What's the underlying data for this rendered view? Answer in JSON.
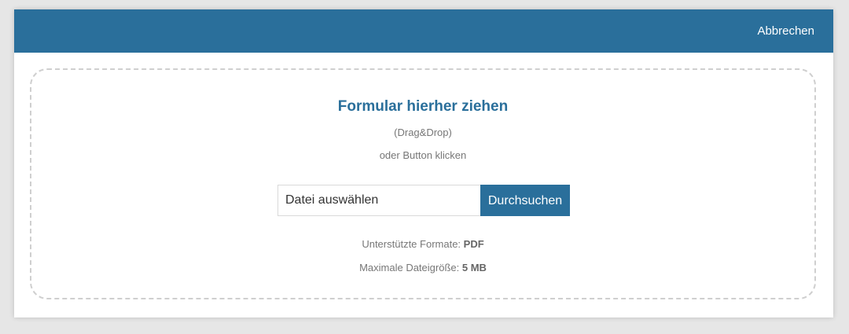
{
  "header": {
    "cancel_label": "Abbrechen"
  },
  "dropzone": {
    "title": "Formular hierher ziehen",
    "dragdrop_hint": "(Drag&Drop)",
    "button_hint": "oder Button klicken",
    "file_input_value": "Datei auswählen",
    "browse_label": "Durchsuchen",
    "formats_label": "Unterstützte Formate: ",
    "formats_value": "PDF",
    "size_label": "Maximale Dateigröße: ",
    "size_value": "5 MB"
  },
  "colors": {
    "accent": "#2a6f9b",
    "background": "#e6e6e6",
    "dropzone_border": "#cfcfcf"
  }
}
